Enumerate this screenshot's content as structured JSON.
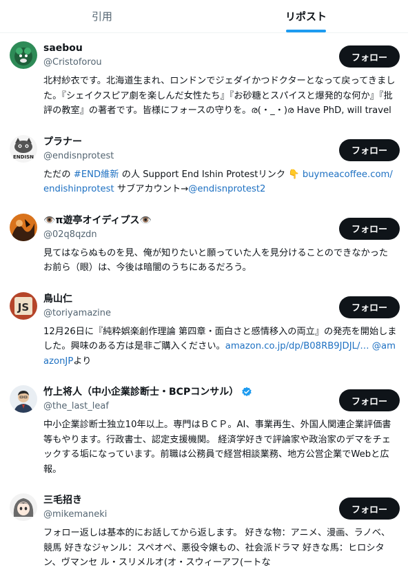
{
  "tabs": [
    {
      "label": "引用",
      "active": false
    },
    {
      "label": "リポスト",
      "active": true
    }
  ],
  "follow_label": "フォロー",
  "accent_color": "#1d9bf0",
  "users": [
    {
      "name": "saebou",
      "handle": "@Cristoforou",
      "avatar_icon": "green-creature-avatar",
      "bio": [
        {
          "text": "北村紗衣です。北海道生まれ、ロンドンでジェダイかつドクターとなって戻ってきました。『シェイクスピア劇を楽しんだ女性たち』『お砂糖とスパイスと爆発的な何か』『批評の教室』の著者です。皆様にフォースの守りを。ര(・_・)ര Have PhD, will travel"
        }
      ]
    },
    {
      "name": "プラナー",
      "handle": "@endisnprotest",
      "avatar_icon": "cat-endisn-avatar",
      "bio": [
        {
          "text": "ただの "
        },
        {
          "text": "#END維新",
          "link": true
        },
        {
          "text": " の人 Support End Ishin Protestリンク 👇 "
        },
        {
          "text": "buymeacoffee.com/endishinprotest",
          "link": true
        },
        {
          "text": " サブアカウント→"
        },
        {
          "text": "@endisnprotest2",
          "link": true
        }
      ]
    },
    {
      "name": "👁️π遊亭オイディプス👁️",
      "handle": "@02q8qzdn",
      "avatar_icon": "orange-illustration-avatar",
      "bio": [
        {
          "text": "見てはならぬものを見、俺が知りたいと願っていた人を見分けることのできなかったお前ら（眼）は、今後は暗闇のうちにあるだろう。"
        }
      ]
    },
    {
      "name": "鳥山仁",
      "handle": "@toriyamazine",
      "avatar_icon": "js-badge-avatar",
      "bio": [
        {
          "text": "12月26日に『純粋娯楽創作理論 第四章・面白さと感情移入の両立』の発売を開始しました。興味のある方は是非ご購入ください。"
        },
        {
          "text": "amazon.co.jp/dp/B08RB9JDJL/…",
          "link": true
        },
        {
          "text": " "
        },
        {
          "text": "@amazonJP",
          "link": true
        },
        {
          "text": "より"
        }
      ]
    },
    {
      "name": "竹上将人（中小企業診断士・BCPコンサル）",
      "handle": "@the_last_leaf",
      "avatar_icon": "businessman-photo-avatar",
      "verified": true,
      "bio": [
        {
          "text": "中小企業診断士独立10年以上。専門はＢＣＰ。AI、事業再生、外国人関連企業評価書等もやります。行政書士、認定支援機関。 経済学好きで評論家や政治家のデマをチェックする垢になっています。前職は公務員で経営相談業務、地方公営企業でWebと広報。"
        }
      ]
    },
    {
      "name": "三毛招き",
      "handle": "@mikemaneki",
      "avatar_icon": "anime-girl-avatar",
      "bio": [
        {
          "text": "フォロー返しは基本的にお話してから返します。 好きな物：アニメ、漫画、ラノベ、競馬 好きなジャンル：スペオペ、悪役令嬢もの、社会派ドラマ 好きな馬：ヒロシタン、ヴマンセ ル・スリメルオ(オ・スウィーアフ(ートな"
        }
      ]
    }
  ]
}
